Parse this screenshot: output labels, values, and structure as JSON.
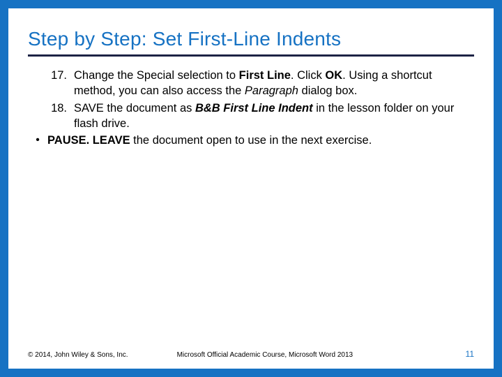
{
  "title": "Step by Step: Set First-Line Indents",
  "items": [
    {
      "num": "17.",
      "segments": [
        {
          "t": "Change the Special selection to "
        },
        {
          "t": "First Line",
          "b": true
        },
        {
          "t": ". Click "
        },
        {
          "t": "OK",
          "b": true
        },
        {
          "t": ". Using a shortcut method, you can also access the "
        },
        {
          "t": "Paragraph",
          "i": true
        },
        {
          "t": " dialog box."
        }
      ]
    },
    {
      "num": "18.",
      "segments": [
        {
          "t": " SAVE the document as "
        },
        {
          "t": "B&B First Line Indent",
          "b": true,
          "i": true
        },
        {
          "t": " in the lesson folder on your flash drive."
        }
      ]
    }
  ],
  "bullet": {
    "mark": "•",
    "segments": [
      {
        "t": "PAUSE. LEAVE ",
        "b": true
      },
      {
        "t": "the document open to use in the next exercise."
      }
    ]
  },
  "footer": {
    "copyright": "© 2014, John Wiley & Sons, Inc.",
    "course": "Microsoft Official Academic Course, Microsoft Word 2013",
    "pagenum": "11"
  }
}
